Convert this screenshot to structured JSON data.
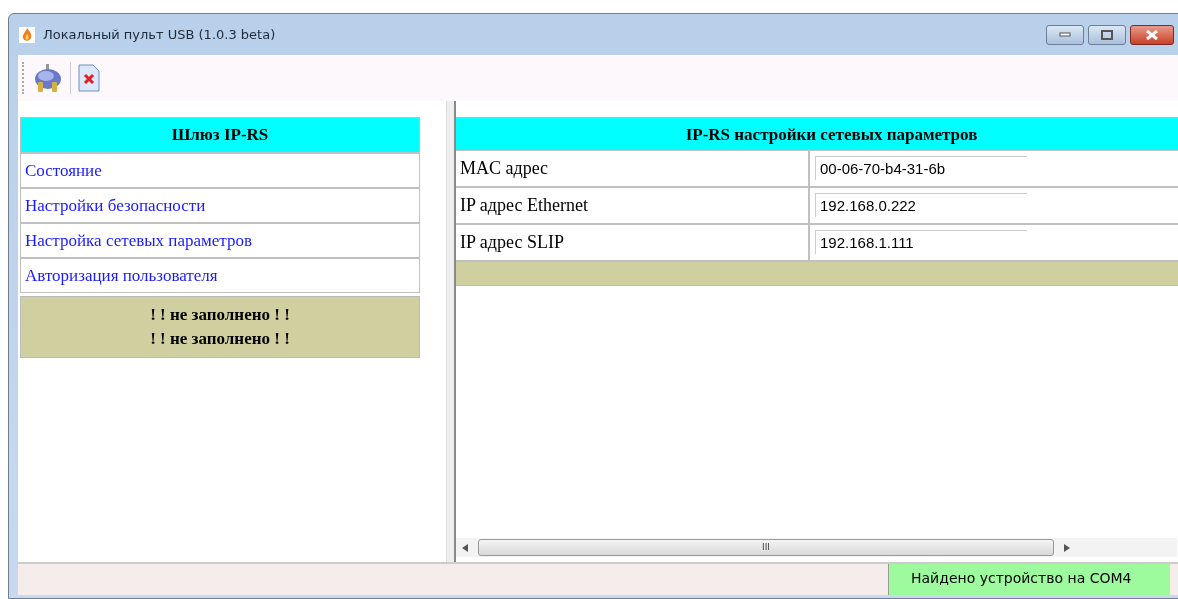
{
  "window": {
    "title": "Локальный пульт USB (1.0.3 beta)"
  },
  "menu": {
    "title": "Шлюз IP-RS",
    "items": [
      {
        "label": "Состояние"
      },
      {
        "label": "Настройки безопасности"
      },
      {
        "label": "Настройка сетевых параметров"
      },
      {
        "label": "Авторизация пользователя"
      }
    ],
    "notices": [
      "! ! не заполнено ! !",
      "! ! не заполнено ! !"
    ]
  },
  "settings": {
    "title": "IP-RS настройки сетевых параметров",
    "rows": [
      {
        "label": "MAC адрес",
        "value": "00-06-70-b4-31-6b"
      },
      {
        "label": "IP адрес Ethernet",
        "value": "192.168.0.222"
      },
      {
        "label": "IP адрес SLIP",
        "value": "192.168.1.111"
      }
    ]
  },
  "scrollbar": {
    "grip": "III"
  },
  "status_bar": {
    "message": "Найдено устройство на COM4"
  }
}
